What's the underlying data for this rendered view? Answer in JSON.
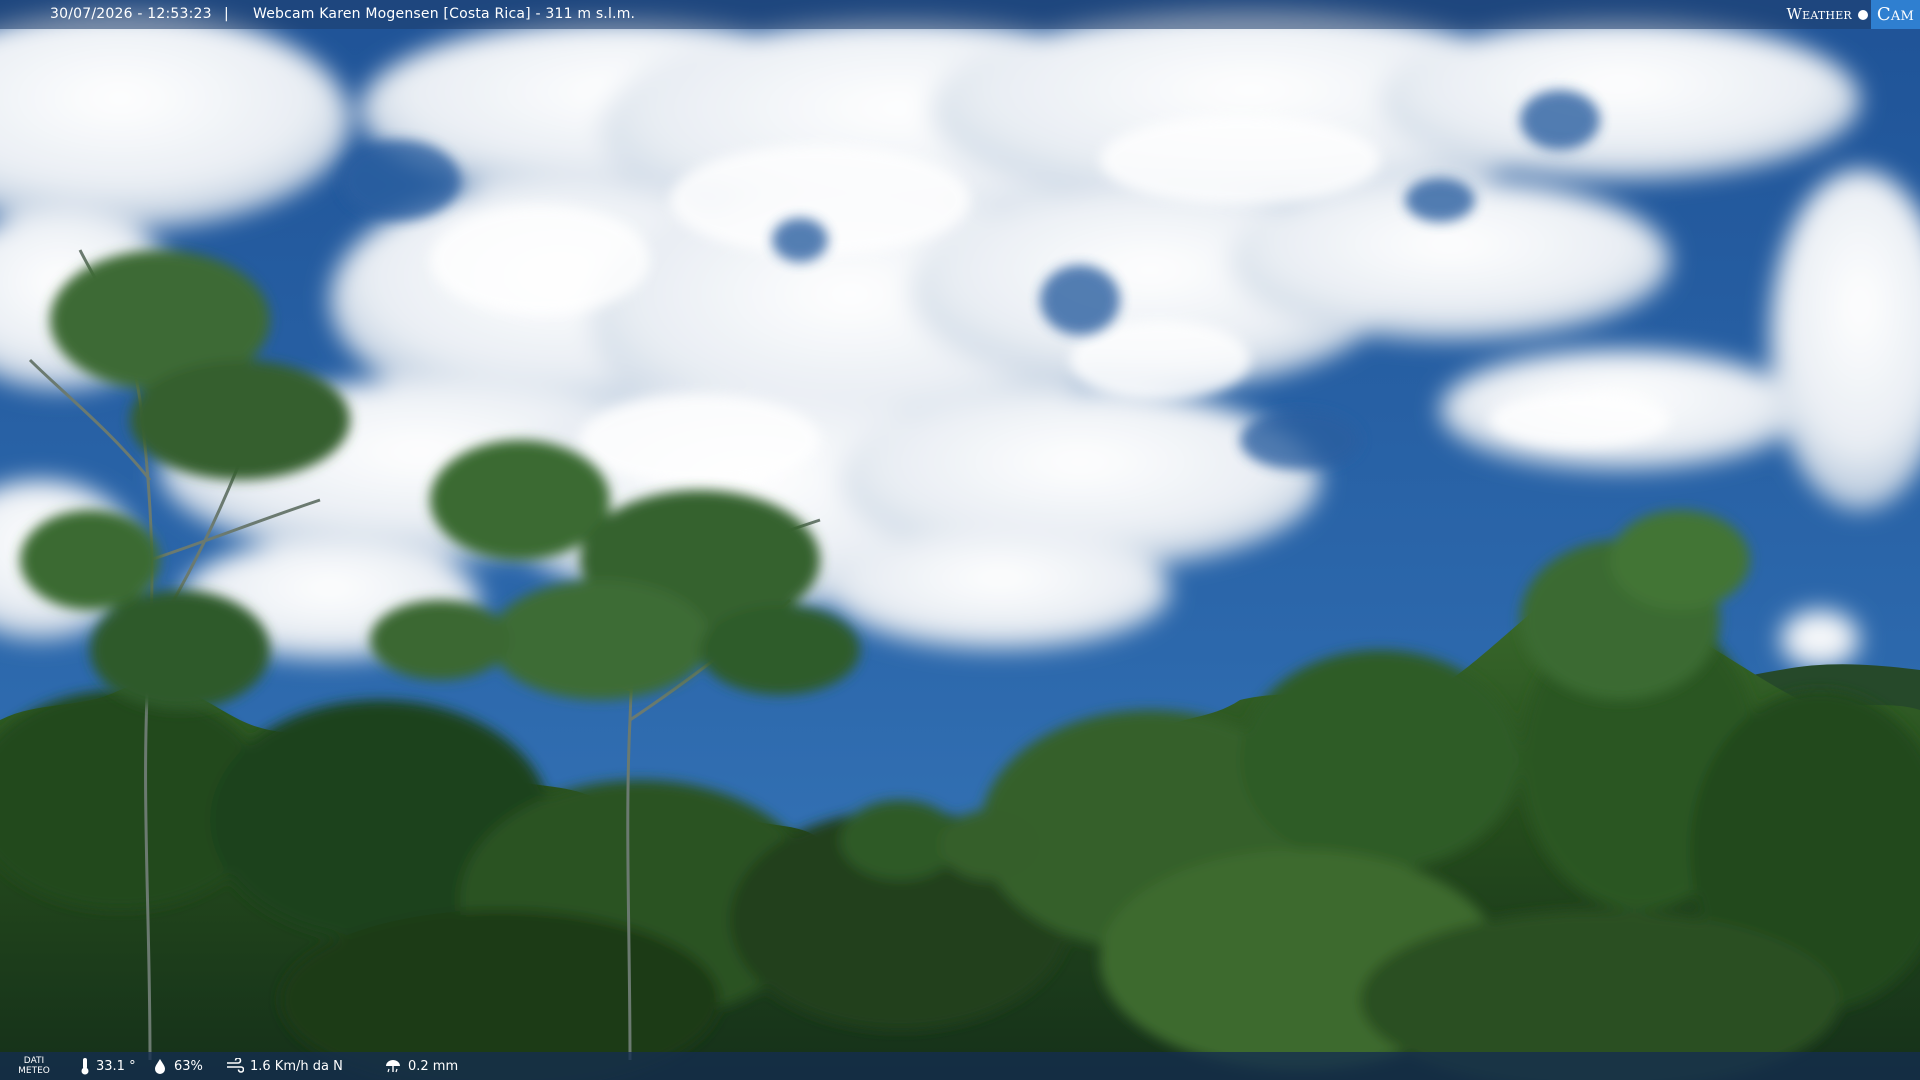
{
  "header": {
    "datetime": "30/07/2026 - 12:53:23",
    "separator": "|",
    "title": "Webcam Karen Mogensen [Costa Rica] - 311 m s.l.m."
  },
  "brand": {
    "weather": "Weather",
    "cam": "Cam"
  },
  "footer": {
    "label_line1": "DATI",
    "label_line2": "METEO",
    "temperature": "33.1 °",
    "humidity": "63%",
    "wind": "1.6 Km/h da N",
    "rain": "0.2 mm",
    "icons": {
      "temperature": "thermometer-icon",
      "humidity": "droplet-icon",
      "wind": "wind-icon",
      "rain": "rain-icon"
    }
  },
  "colors": {
    "sky": "#2c65a8",
    "sky_dark": "#1e4f8e",
    "cloud": "#f4f6f9",
    "foliage_dark": "#163617",
    "foliage": "#2e5e24",
    "foliage_light": "#4d7b3a",
    "bar_top": "#1e3c69",
    "bar_bottom": "#142d50",
    "brand_accent": "#2f7fd0"
  }
}
